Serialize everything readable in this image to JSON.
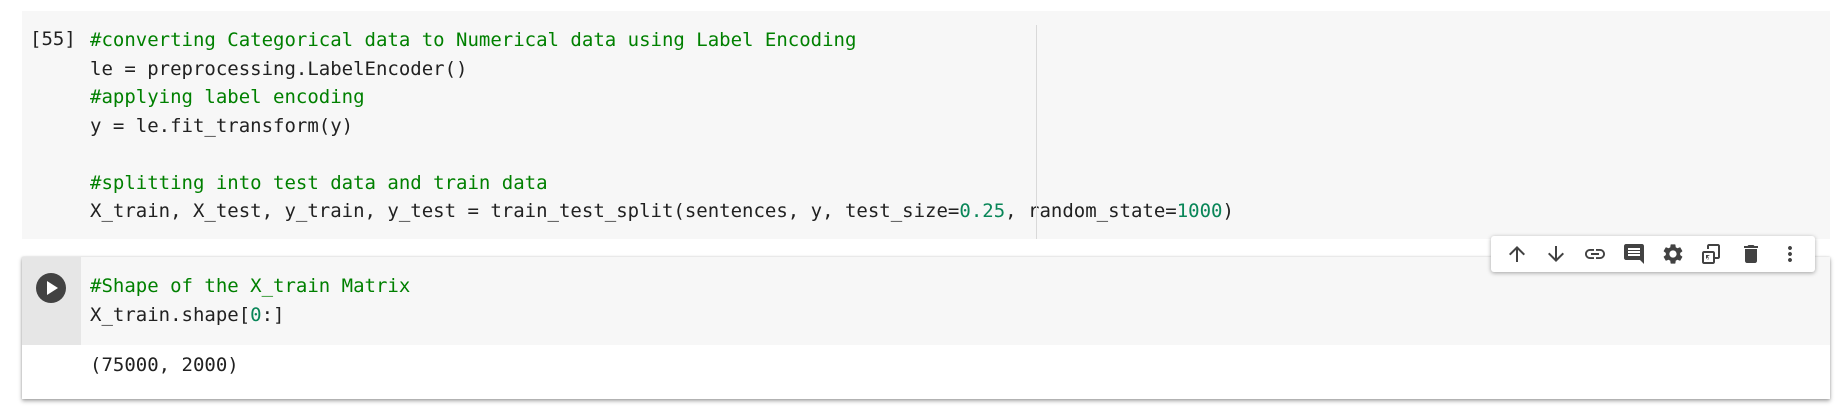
{
  "cell1": {
    "execution_count": "[55]",
    "code_lines": [
      {
        "segments": [
          {
            "t": "#converting Categorical data to Numerical data using Label Encoding",
            "c": "cm"
          }
        ]
      },
      {
        "segments": [
          {
            "t": "le = preprocessing.LabelEncoder()",
            "c": ""
          }
        ]
      },
      {
        "segments": [
          {
            "t": "#applying label encoding",
            "c": "cm"
          }
        ]
      },
      {
        "segments": [
          {
            "t": "y = le.fit_transform(y)",
            "c": ""
          }
        ]
      },
      {
        "segments": [
          {
            "t": "",
            "c": ""
          }
        ]
      },
      {
        "segments": [
          {
            "t": "#splitting into test data and train data",
            "c": "cm"
          }
        ]
      },
      {
        "segments": [
          {
            "t": "X_train, X_test, y_train, y_test = train_test_split(sentences, y, test_size=",
            "c": ""
          },
          {
            "t": "0.25",
            "c": "num"
          },
          {
            "t": ", random_state=",
            "c": ""
          },
          {
            "t": "1000",
            "c": "num"
          },
          {
            "t": ")",
            "c": ""
          }
        ]
      }
    ]
  },
  "cell2": {
    "run_button_icon": "play-icon",
    "code_lines": [
      {
        "segments": [
          {
            "t": "#Shape of the X_train Matrix",
            "c": "cm"
          }
        ]
      },
      {
        "segments": [
          {
            "t": "X_train.shape[",
            "c": ""
          },
          {
            "t": "0",
            "c": "num"
          },
          {
            "t": ":]",
            "c": ""
          }
        ]
      }
    ],
    "output": "(75000, 2000)"
  },
  "toolbar": {
    "buttons": [
      {
        "icon": "arrow-up-icon",
        "name": "move-cell-up-button"
      },
      {
        "icon": "arrow-down-icon",
        "name": "move-cell-down-button"
      },
      {
        "icon": "link-icon",
        "name": "copy-link-button"
      },
      {
        "icon": "comment-icon",
        "name": "add-comment-button"
      },
      {
        "icon": "gear-icon",
        "name": "cell-settings-button"
      },
      {
        "icon": "mirror-cell-icon",
        "name": "mirror-cell-button"
      },
      {
        "icon": "trash-icon",
        "name": "delete-cell-button"
      },
      {
        "icon": "more-vert-icon",
        "name": "more-actions-button"
      }
    ]
  },
  "colors": {
    "comment": "#008000",
    "number": "#098658",
    "text": "#212121",
    "cell_background": "#f7f7f7"
  }
}
